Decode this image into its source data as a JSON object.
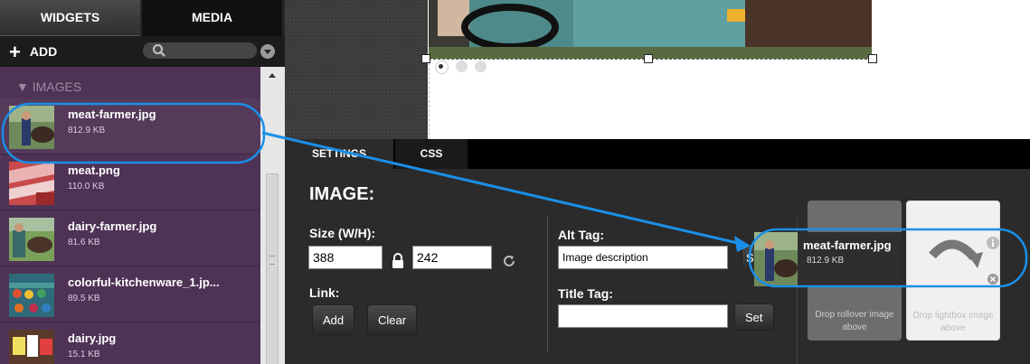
{
  "sidebar": {
    "tabs": {
      "widgets": "WIDGETS",
      "media": "MEDIA"
    },
    "add_label": "ADD",
    "search_placeholder": "",
    "section_heading": "▼ IMAGES",
    "items": [
      {
        "name": "meat-farmer.jpg",
        "size": "812.9 KB"
      },
      {
        "name": "meat.png",
        "size": "110.0 KB"
      },
      {
        "name": "dairy-farmer.jpg",
        "size": "81.6 KB"
      },
      {
        "name": "colorful-kitchenware_1.jp...",
        "size": "89.5 KB"
      },
      {
        "name": "dairy.jpg",
        "size": "15.1 KB"
      }
    ]
  },
  "properties": {
    "tabs": {
      "settings": "SETTINGS",
      "css": "CSS"
    },
    "title": "IMAGE:",
    "size_label": "Size (W/H):",
    "width": "388",
    "height": "242",
    "link_label": "Link:",
    "add_button": "Add",
    "clear_button": "Clear",
    "alt_label": "Alt Tag:",
    "alt_value": "Image description",
    "alt_set_button": "S",
    "title_label": "Title Tag:",
    "title_value": "",
    "title_set_button": "Set",
    "drop_rollover": "Drop rollover image above",
    "drop_lightbox": "Drop lightbox image above",
    "drag_preview": {
      "name": "meat-farmer.jpg",
      "size": "812.9 KB"
    }
  },
  "colors": {
    "accent_annotation": "#1a8fe8",
    "media_list_bg": "#4f3355",
    "panel_bg": "#2b2b2b"
  }
}
